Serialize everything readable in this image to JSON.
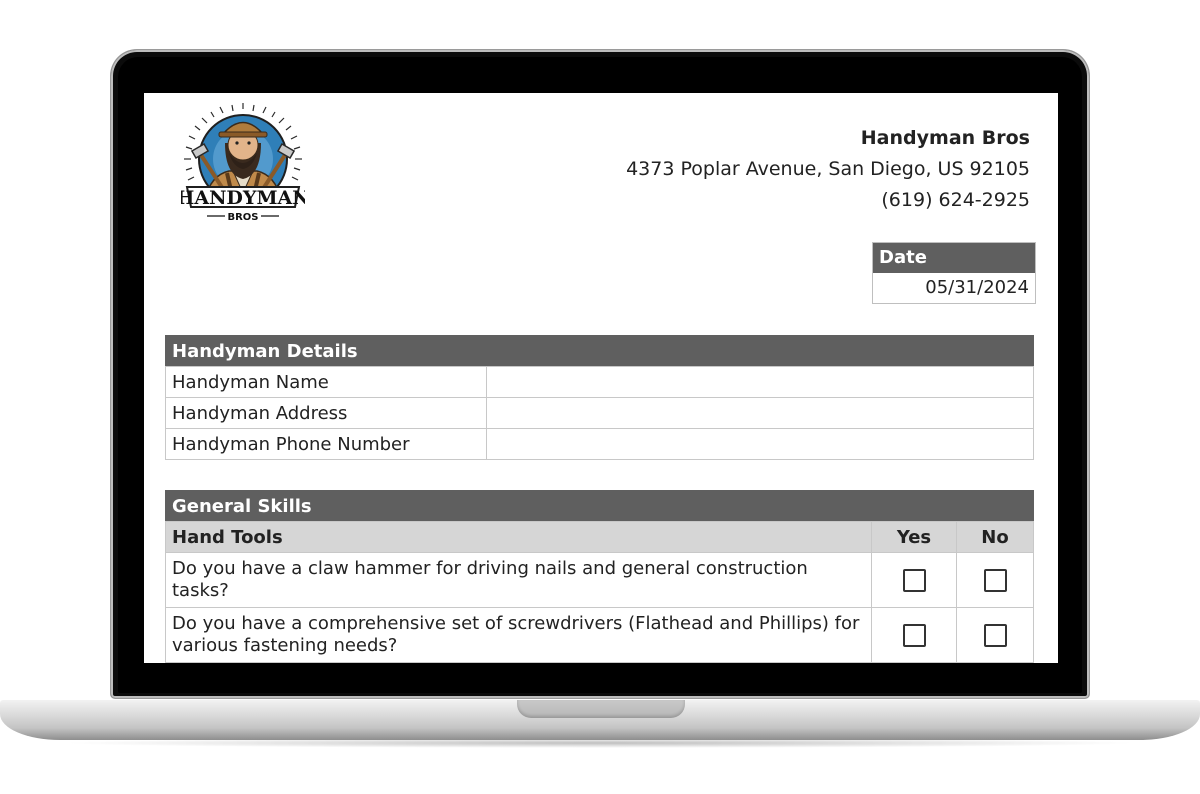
{
  "company": {
    "logo_text": "HANDYMAN",
    "logo_subtext": "BROS",
    "name": "Handyman Bros",
    "address": "4373 Poplar Avenue, San Diego, US 92105",
    "phone": "(619) 624-2925"
  },
  "date": {
    "label": "Date",
    "value": "05/31/2024"
  },
  "handyman_details": {
    "title": "Handyman Details",
    "rows": [
      {
        "label": "Handyman Name",
        "value": ""
      },
      {
        "label": "Handyman Address",
        "value": ""
      },
      {
        "label": "Handyman Phone Number",
        "value": ""
      }
    ]
  },
  "general_skills": {
    "title": "General Skills",
    "subheader": {
      "label": "Hand Tools",
      "yes": "Yes",
      "no": "No"
    },
    "questions": [
      {
        "text": "Do you have a claw hammer for driving nails and general construction tasks?",
        "yes": false,
        "no": false
      },
      {
        "text": "Do you have a comprehensive set of screwdrivers (Flathead and Phillips) for various fastening needs?",
        "yes": false,
        "no": false
      }
    ]
  },
  "colors": {
    "header_bg": "#5f5f5f",
    "subheader_bg": "#d6d6d6",
    "border": "#c8c8c8"
  }
}
